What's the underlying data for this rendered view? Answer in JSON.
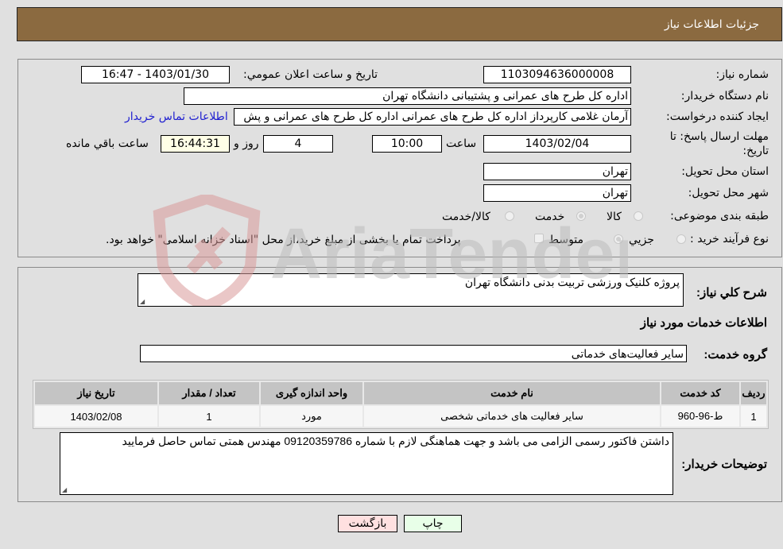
{
  "header": {
    "title": "جزئیات اطلاعات نیاز"
  },
  "form": {
    "need_number_label": "شماره نیاز:",
    "need_number": "1103094636000008",
    "announce_label": "تاريخ و ساعت اعلان عمومي:",
    "announce_value": "1403/01/30 - 16:47",
    "buyer_org_label": "نام دستگاه خریدار:",
    "buyer_org": "اداره کل طرح های عمرانی و پشتیبانی دانشگاه تهران",
    "creator_label": "ایجاد کننده درخواست:",
    "creator": "آرمان غلامی کارپرداز اداره کل طرح های عمرانی اداره کل طرح های عمرانی و پش",
    "contact_link": "اطلاعات تماس خریدار",
    "deadline_label": "مهلت ارسال پاسخ: تا تاریخ:",
    "deadline_date": "1403/02/04",
    "time_label": "ساعت",
    "deadline_time": "10:00",
    "days_value": "4",
    "days_label": "روز و",
    "remaining_time": "16:44:31",
    "remaining_label": "ساعت باقي مانده",
    "province_label": "استان محل تحویل:",
    "province": "تهران",
    "city_label": "شهر محل تحویل:",
    "city": "تهران",
    "category_label": "طبقه بندی موضوعی:",
    "category_options": [
      "کالا",
      "خدمت",
      "کالا/خدمت"
    ],
    "category_selected": "خدمت",
    "purchase_type_label": "نوع فرآیند خرید :",
    "purchase_options": [
      "جزيي",
      "متوسط"
    ],
    "purchase_selected": "متوسط",
    "treasury_note": "پرداخت تمام یا بخشی از مبلغ خرید،از محل \"اسناد خزانه اسلامی\" خواهد بود."
  },
  "details": {
    "summary_label": "شرح كلي نياز:",
    "summary": "پروژه کلنیک ورزشی تربیت بدنی دانشگاه تهران",
    "services_title": "اطلاعات خدمات مورد نیاز",
    "service_group_label": "گروه خدمت:",
    "service_group": "سایر فعالیت‌های خدماتی",
    "table": {
      "headers": [
        "ردیف",
        "کد خدمت",
        "نام خدمت",
        "واحد اندازه گیری",
        "تعداد / مقدار",
        "تاریخ نیاز"
      ],
      "rows": [
        [
          "1",
          "ط-96-960",
          "سایر فعالیت های خدماتی شخصی",
          "مورد",
          "1",
          "1403/02/08"
        ]
      ]
    },
    "buyer_notes_label": "توضیحات خریدار:",
    "buyer_notes": "داشتن فاکتور رسمی الزامی می باشد و جهت هماهنگی لازم با شماره 09120359786 مهندس همتی تماس حاصل فرمایید"
  },
  "buttons": {
    "print": "چاپ",
    "back": "بازگشت"
  },
  "watermark": {
    "text": "AriaTender.neT"
  },
  "colors": {
    "header_bg": "#8b6a40",
    "print_bg": "#e8ffe8",
    "back_bg": "#ffe0e0",
    "link": "#2020d0"
  }
}
